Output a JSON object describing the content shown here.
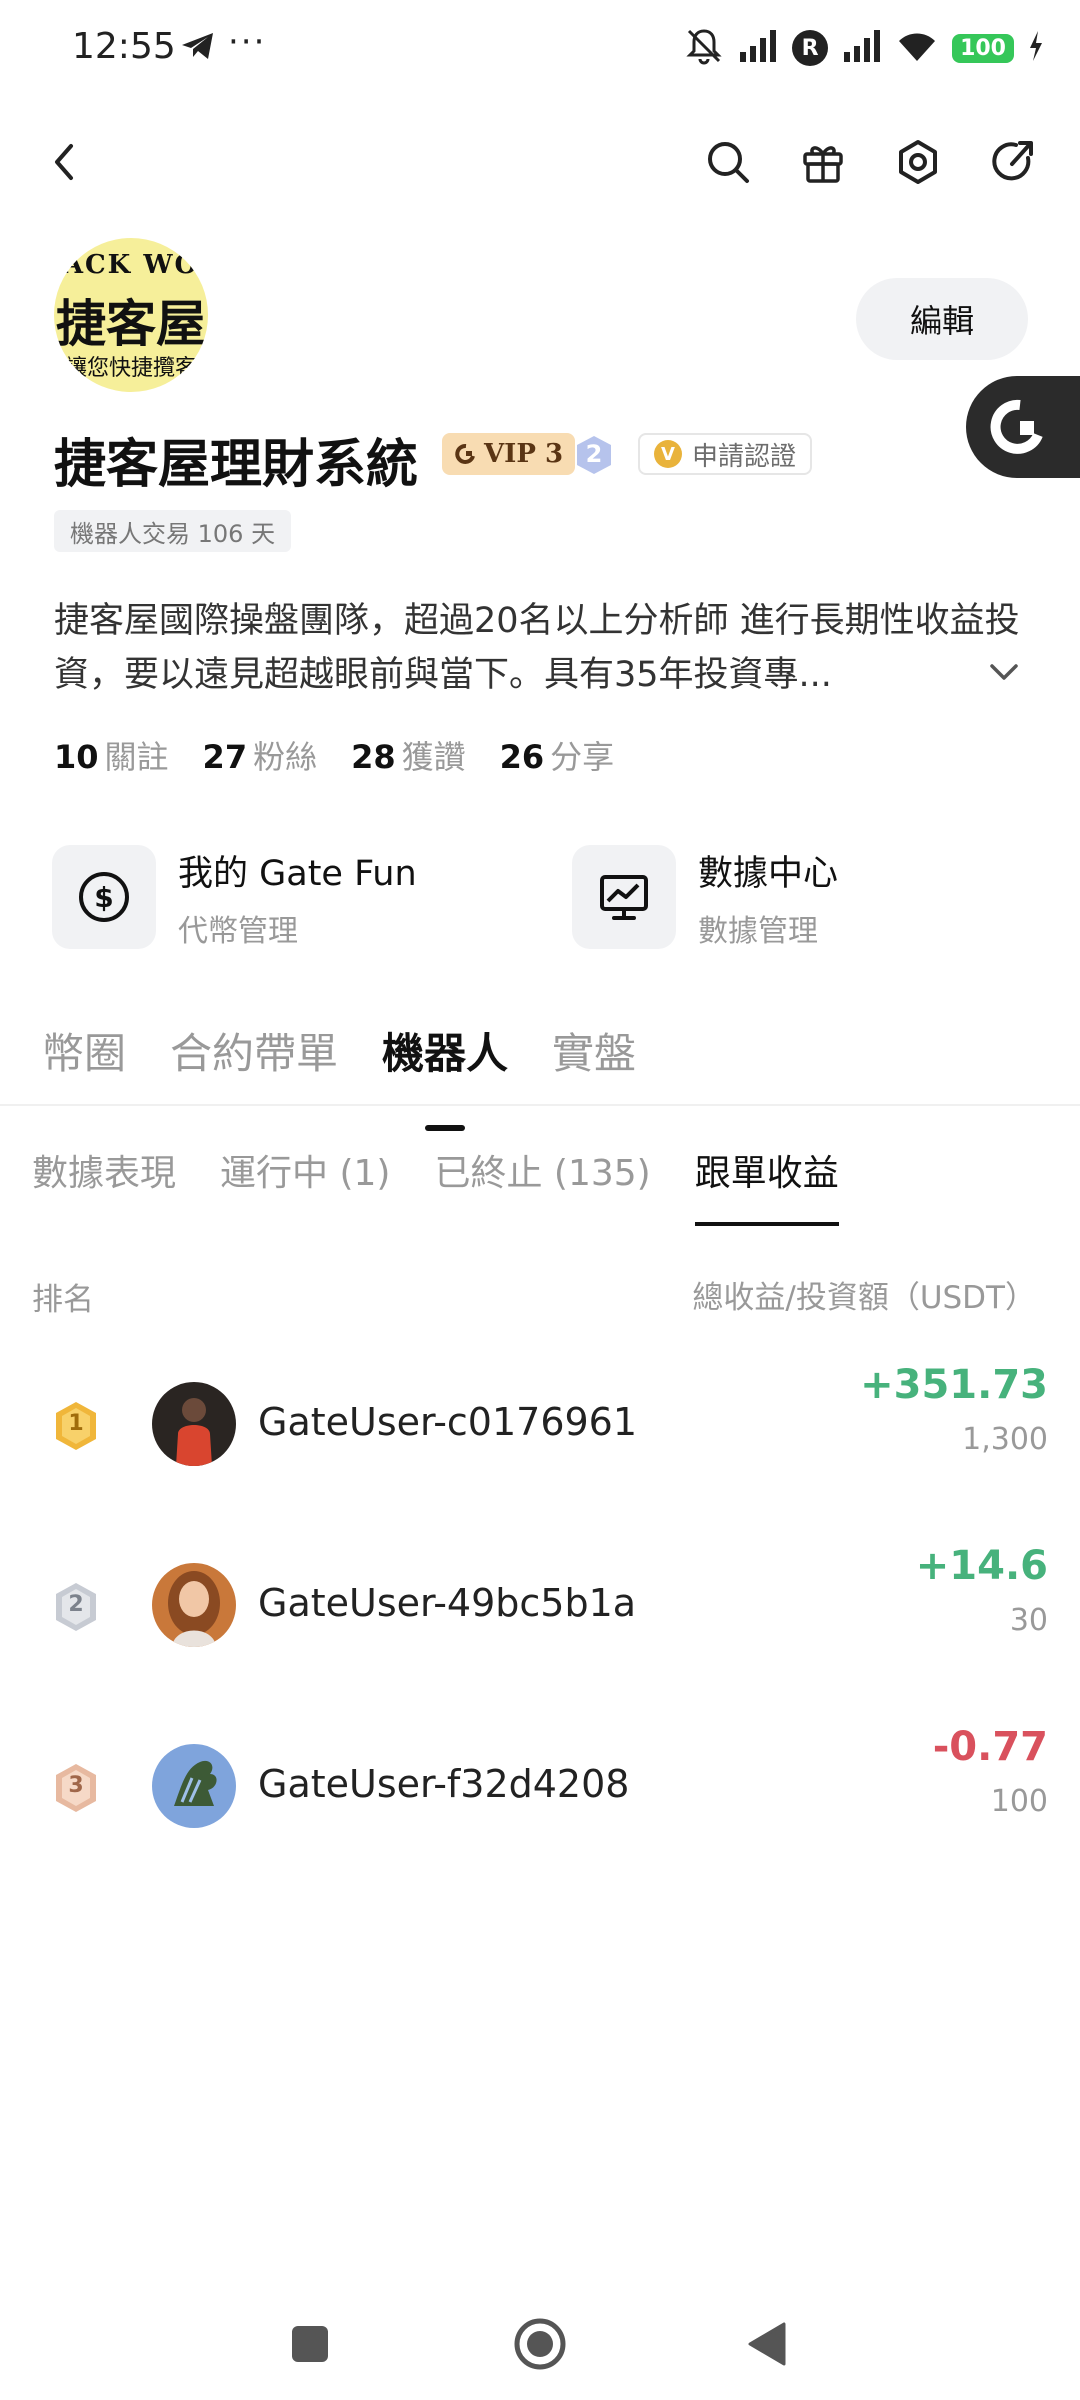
{
  "status_bar": {
    "time": "12:55",
    "dots": "···",
    "r_badge": "R",
    "battery": "100"
  },
  "profile": {
    "avatar_text": {
      "line1": "ACK WO",
      "line2": "捷客屋",
      "line3": "讓您快捷攬客"
    },
    "edit_label": "編輯",
    "name": "捷客屋理財系統",
    "vip_label": "VIP 3",
    "level_number": "2",
    "verify_label": "申請認證",
    "verify_icon_letter": "V",
    "bot_tag": "機器人交易 106 天",
    "bio": "捷客屋國際操盤團隊，超過20名以上分析師 進行長期性收益投資，要以遠見超越眼前與當下。具有35年投資專...",
    "stats": [
      {
        "num": "10",
        "label": "關註"
      },
      {
        "num": "27",
        "label": "粉絲"
      },
      {
        "num": "28",
        "label": "獲讚"
      },
      {
        "num": "26",
        "label": "分享"
      }
    ]
  },
  "tools": [
    {
      "title": "我的 Gate Fun",
      "sub": "代幣管理",
      "icon": "dollar-circle-icon"
    },
    {
      "title": "數據中心",
      "sub": "數據管理",
      "icon": "chart-monitor-icon"
    }
  ],
  "main_tabs": [
    "幣圈",
    "合約帶單",
    "機器人",
    "實盤"
  ],
  "main_tab_active": 2,
  "sub_tabs": [
    "數據表現",
    "運行中 (1)",
    "已終止 (135)",
    "跟單收益"
  ],
  "sub_tab_active": 3,
  "leaderboard": {
    "head_left": "排名",
    "head_right": "總收益/投資額（USDT）",
    "rows": [
      {
        "rank": "1",
        "user": "GateUser-c0176961",
        "profit": "+351.73",
        "invest": "1,300",
        "medal_color": "#f0b63a"
      },
      {
        "rank": "2",
        "user": "GateUser-49bc5b1a",
        "profit": "+14.6",
        "invest": "30",
        "medal_color": "#b8bdc7"
      },
      {
        "rank": "3",
        "user": "GateUser-f32d4208",
        "profit": "-0.77",
        "invest": "100",
        "medal_color": "#e7b9a0"
      }
    ]
  },
  "colors": {
    "positive": "#47b27c",
    "negative": "#d9515d",
    "battery": "#35c759"
  }
}
